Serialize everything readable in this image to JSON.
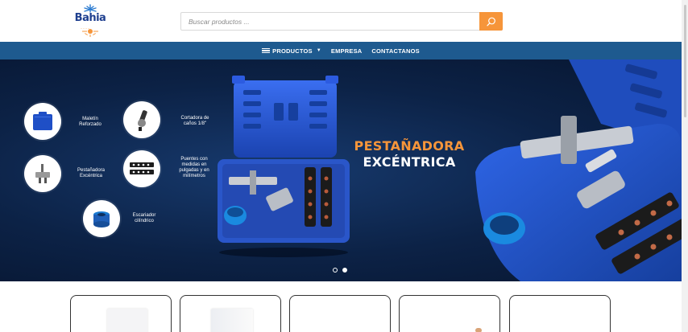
{
  "brand": {
    "logo_text": "Bahia",
    "logo_icon": "snowflake-sun-logo"
  },
  "search": {
    "placeholder": "Buscar productos ...",
    "value": "",
    "button_icon": "search-icon"
  },
  "nav": {
    "items": [
      {
        "label": "PRODUCTOS",
        "icon": "menu-icon",
        "has_dropdown": true
      },
      {
        "label": "EMPRESA"
      },
      {
        "label": "CONTACTANOS"
      }
    ]
  },
  "hero": {
    "headline_1": "PESTAÑADORA",
    "headline_2": "EXCÉNTRICA",
    "features": [
      {
        "label": "Maletín\nReforzado",
        "icon": "case-icon"
      },
      {
        "label": "Cortadora de\ncaños 1/8\"",
        "icon": "pipe-cutter-icon"
      },
      {
        "label": "Pestañadora\nExcéntrica",
        "icon": "flaring-tool-icon"
      },
      {
        "label": "Puentes con\nmedidas en\npulgadas y en\nmilímetros",
        "icon": "flaring-bar-icon"
      },
      {
        "label": "Escariador\ncilíndrico",
        "icon": "reamer-icon"
      }
    ],
    "slides": 2,
    "active_slide": 2
  },
  "colors": {
    "accent": "#f6953a",
    "nav_bg": "#1e5a8f",
    "hero_bg": "#0c2246",
    "brand_blue": "#1e3f8f",
    "tool_blue": "#2a56c9"
  },
  "products": {
    "cards": 5
  }
}
